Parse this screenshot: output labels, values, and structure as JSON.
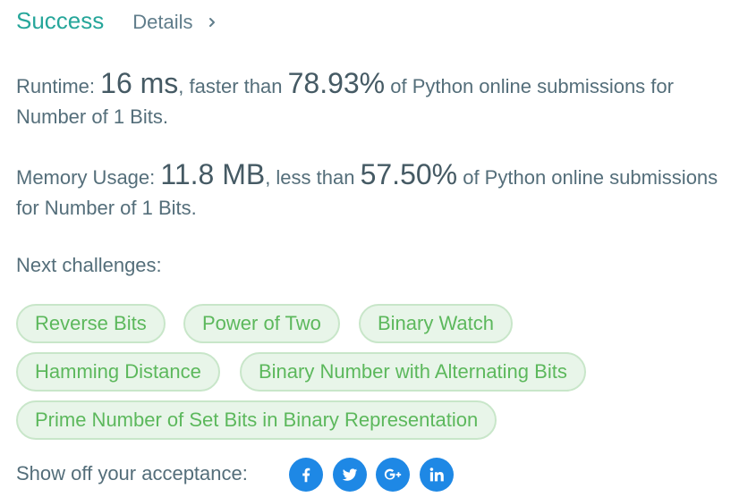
{
  "status": {
    "text": "Success",
    "details_label": "Details"
  },
  "runtime": {
    "prefix": "Runtime: ",
    "value": "16 ms",
    "middle": ", faster than ",
    "percent": "78.93%",
    "suffix": " of Python online submissions for Number of 1 Bits."
  },
  "memory": {
    "prefix": "Memory Usage: ",
    "value": "11.8 MB",
    "middle": ", less than ",
    "percent": "57.50%",
    "suffix": " of Python online submissions for Number of 1 Bits."
  },
  "next_challenges": {
    "label": "Next challenges:",
    "items": [
      "Reverse Bits",
      "Power of Two",
      "Binary Watch",
      "Hamming Distance",
      "Binary Number with Alternating Bits",
      "Prime Number of Set Bits in Binary Representation"
    ]
  },
  "share": {
    "label": "Show off your acceptance:",
    "icons": [
      "facebook-icon",
      "twitter-icon",
      "google-plus-icon",
      "linkedin-icon"
    ],
    "color": "#1e88e5"
  },
  "colors": {
    "success": "#26a69a",
    "chip_text": "#5cb85c",
    "chip_bg": "#e8f5e9",
    "chip_border": "#c8e6c9"
  }
}
